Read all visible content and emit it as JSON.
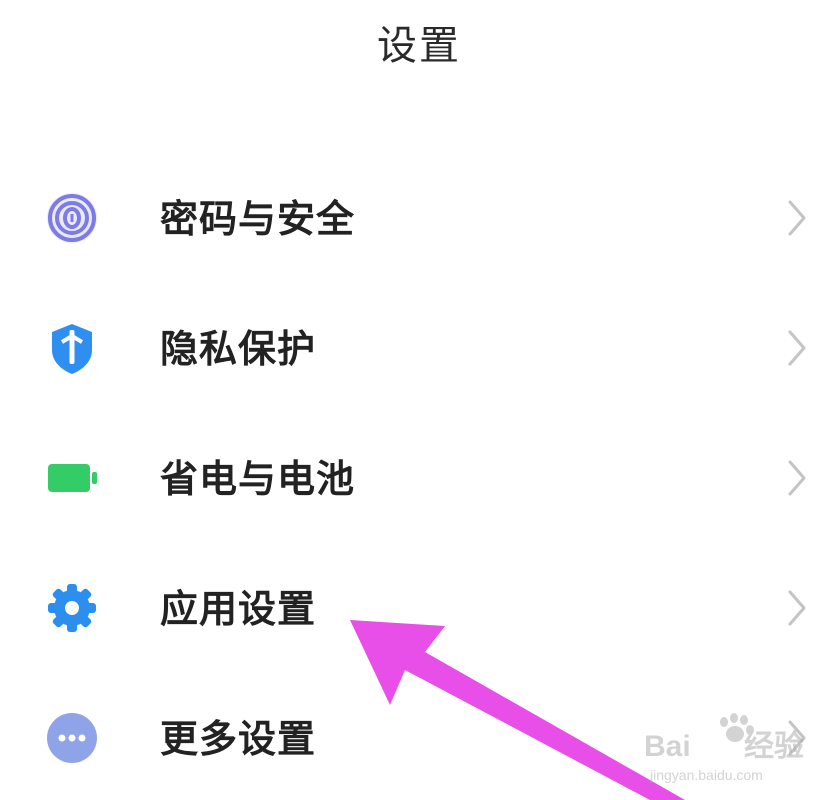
{
  "header": {
    "title": "设置"
  },
  "settings": {
    "items": [
      {
        "label": "密码与安全",
        "icon": "fingerprint-icon",
        "color": "#7d7be6"
      },
      {
        "label": "隐私保护",
        "icon": "privacy-shield-icon",
        "color": "#2f8ff0"
      },
      {
        "label": "省电与电池",
        "icon": "battery-icon",
        "color": "#33cc66"
      },
      {
        "label": "应用设置",
        "icon": "gear-icon",
        "color": "#2c8ff0"
      },
      {
        "label": "更多设置",
        "icon": "more-dots-icon",
        "color": "#8fa3e8"
      }
    ]
  },
  "annotation": {
    "arrow_color": "#e84ee8",
    "points_to": "应用设置"
  },
  "watermark": {
    "logo_text": "Bai du 经验",
    "url": "jingyan.baidu.com"
  },
  "theme": {
    "background": "#ffffff",
    "chevron_color": "#c4c4c4"
  }
}
